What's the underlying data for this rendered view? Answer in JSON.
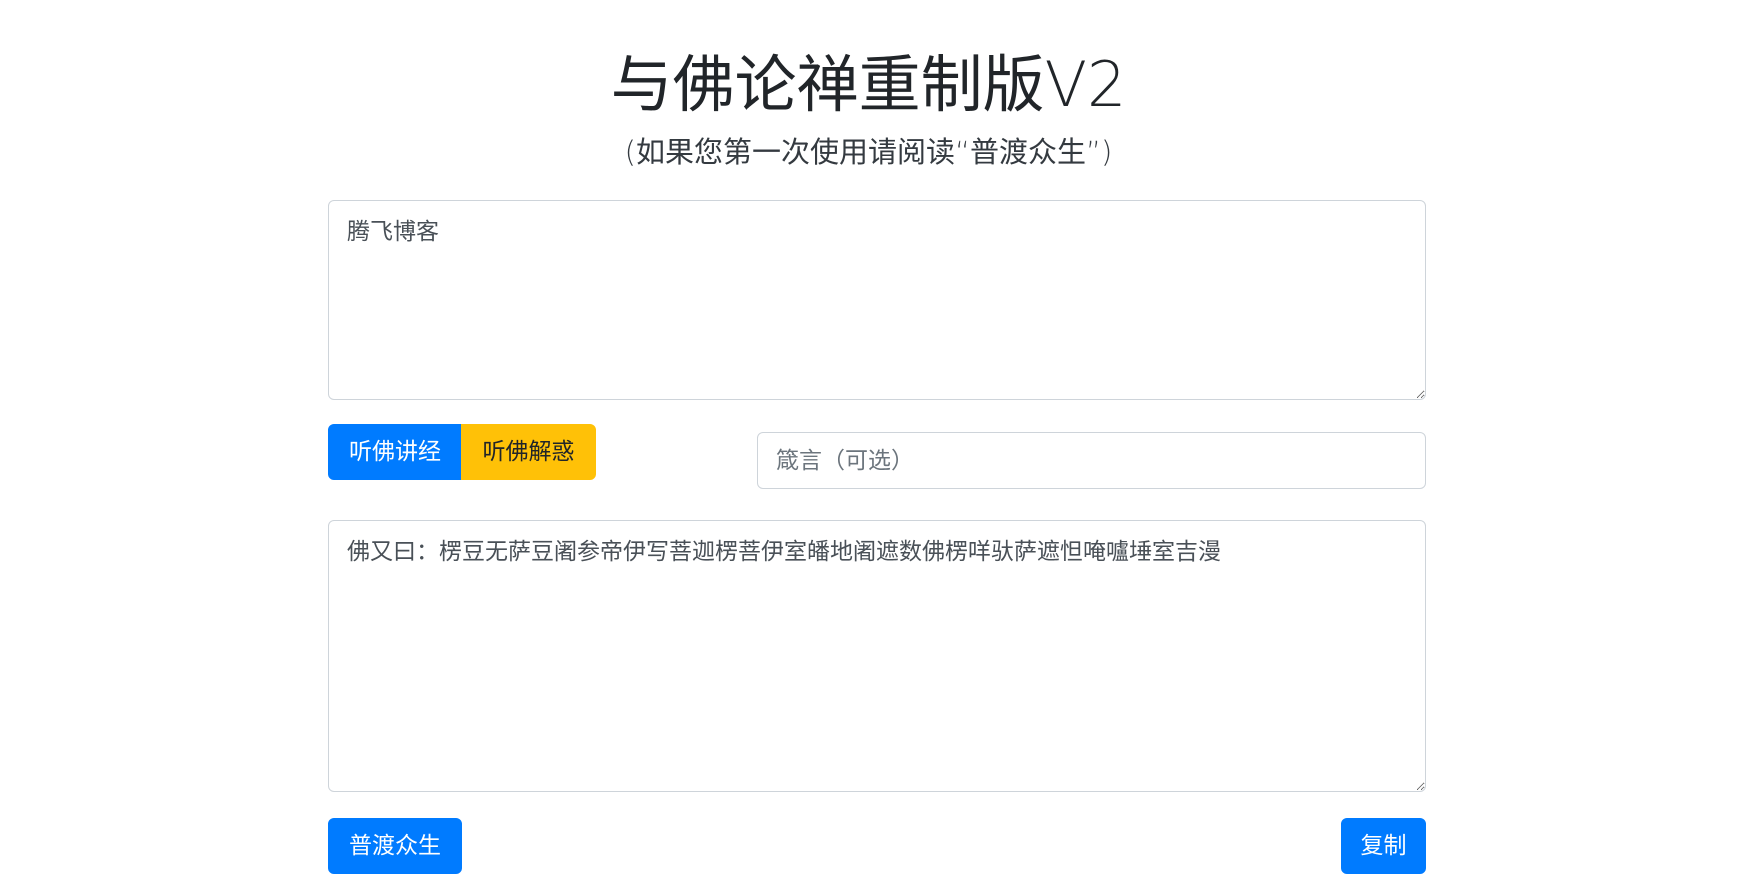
{
  "header": {
    "title": "与佛论禅重制版V2",
    "subtitle": "(如果您第一次使用请阅读“普渡众生”)"
  },
  "input": {
    "value": "腾飞博客"
  },
  "actions": {
    "encode_label": "听佛讲经",
    "decode_label": "听佛解惑"
  },
  "key": {
    "placeholder": "箴言（可选）",
    "value": ""
  },
  "output": {
    "value": "佛又曰：楞豆无萨豆阇参帝伊写菩迦楞菩伊室皤地阇遮数佛楞咩驮萨遮怛唵嚧埵室吉漫"
  },
  "footer": {
    "help_label": "普渡众生",
    "copy_label": "复制"
  },
  "colors": {
    "primary": "#007bff",
    "warning": "#ffc107",
    "border": "#ced4da",
    "text": "#212529"
  }
}
